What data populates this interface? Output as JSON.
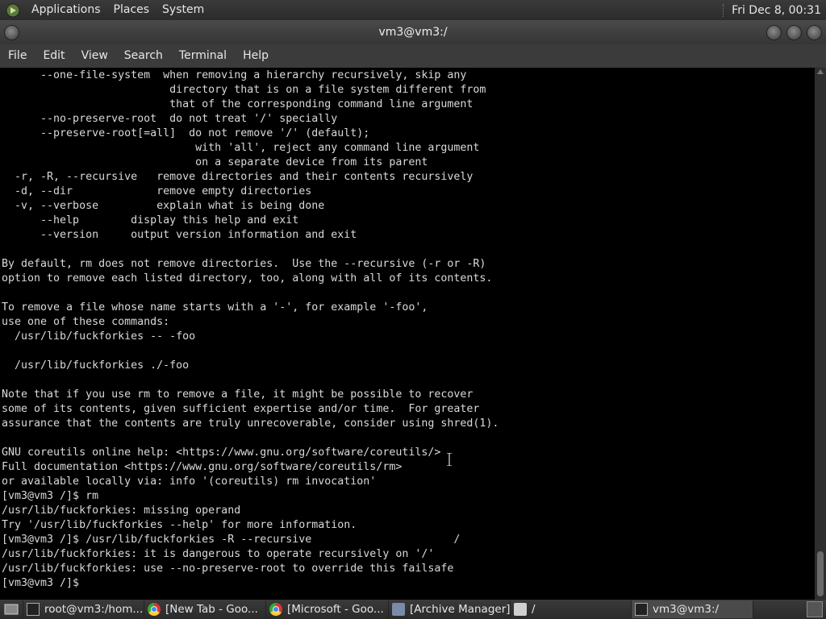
{
  "top_panel": {
    "menus": [
      "Applications",
      "Places",
      "System"
    ],
    "clock": "Fri Dec 8, 00:31"
  },
  "window": {
    "title": "vm3@vm3:/",
    "menu": [
      "File",
      "Edit",
      "View",
      "Search",
      "Terminal",
      "Help"
    ]
  },
  "terminal": {
    "lines": [
      "      --one-file-system  when removing a hierarchy recursively, skip any",
      "                          directory that is on a file system different from",
      "                          that of the corresponding command line argument",
      "      --no-preserve-root  do not treat '/' specially",
      "      --preserve-root[=all]  do not remove '/' (default);",
      "                              with 'all', reject any command line argument",
      "                              on a separate device from its parent",
      "  -r, -R, --recursive   remove directories and their contents recursively",
      "  -d, --dir             remove empty directories",
      "  -v, --verbose         explain what is being done",
      "      --help        display this help and exit",
      "      --version     output version information and exit",
      "",
      "By default, rm does not remove directories.  Use the --recursive (-r or -R)",
      "option to remove each listed directory, too, along with all of its contents.",
      "",
      "To remove a file whose name starts with a '-', for example '-foo',",
      "use one of these commands:",
      "  /usr/lib/fuckforkies -- -foo",
      "",
      "  /usr/lib/fuckforkies ./-foo",
      "",
      "Note that if you use rm to remove a file, it might be possible to recover",
      "some of its contents, given sufficient expertise and/or time.  For greater",
      "assurance that the contents are truly unrecoverable, consider using shred(1).",
      "",
      "GNU coreutils online help: <https://www.gnu.org/software/coreutils/>",
      "Full documentation <https://www.gnu.org/software/coreutils/rm>",
      "or available locally via: info '(coreutils) rm invocation'",
      "[vm3@vm3 /]$ rm",
      "/usr/lib/fuckforkies: missing operand",
      "Try '/usr/lib/fuckforkies --help' for more information.",
      "[vm3@vm3 /]$ /usr/lib/fuckforkies -R --recursive                      /",
      "/usr/lib/fuckforkies: it is dangerous to operate recursively on '/'",
      "/usr/lib/fuckforkies: use --no-preserve-root to override this failsafe",
      "[vm3@vm3 /]$ "
    ]
  },
  "taskbar": {
    "tasks": [
      {
        "label": "root@vm3:/hom...",
        "icon": "terminal-icon"
      },
      {
        "label": "[New Tab - Goo...",
        "icon": "chrome-icon"
      },
      {
        "label": "[Microsoft - Goo...",
        "icon": "chrome-icon"
      },
      {
        "label": "[Archive Manager]",
        "icon": "archive-icon"
      },
      {
        "label": "/",
        "icon": "folder-icon"
      },
      {
        "label": "vm3@vm3:/",
        "icon": "terminal-icon"
      }
    ]
  }
}
